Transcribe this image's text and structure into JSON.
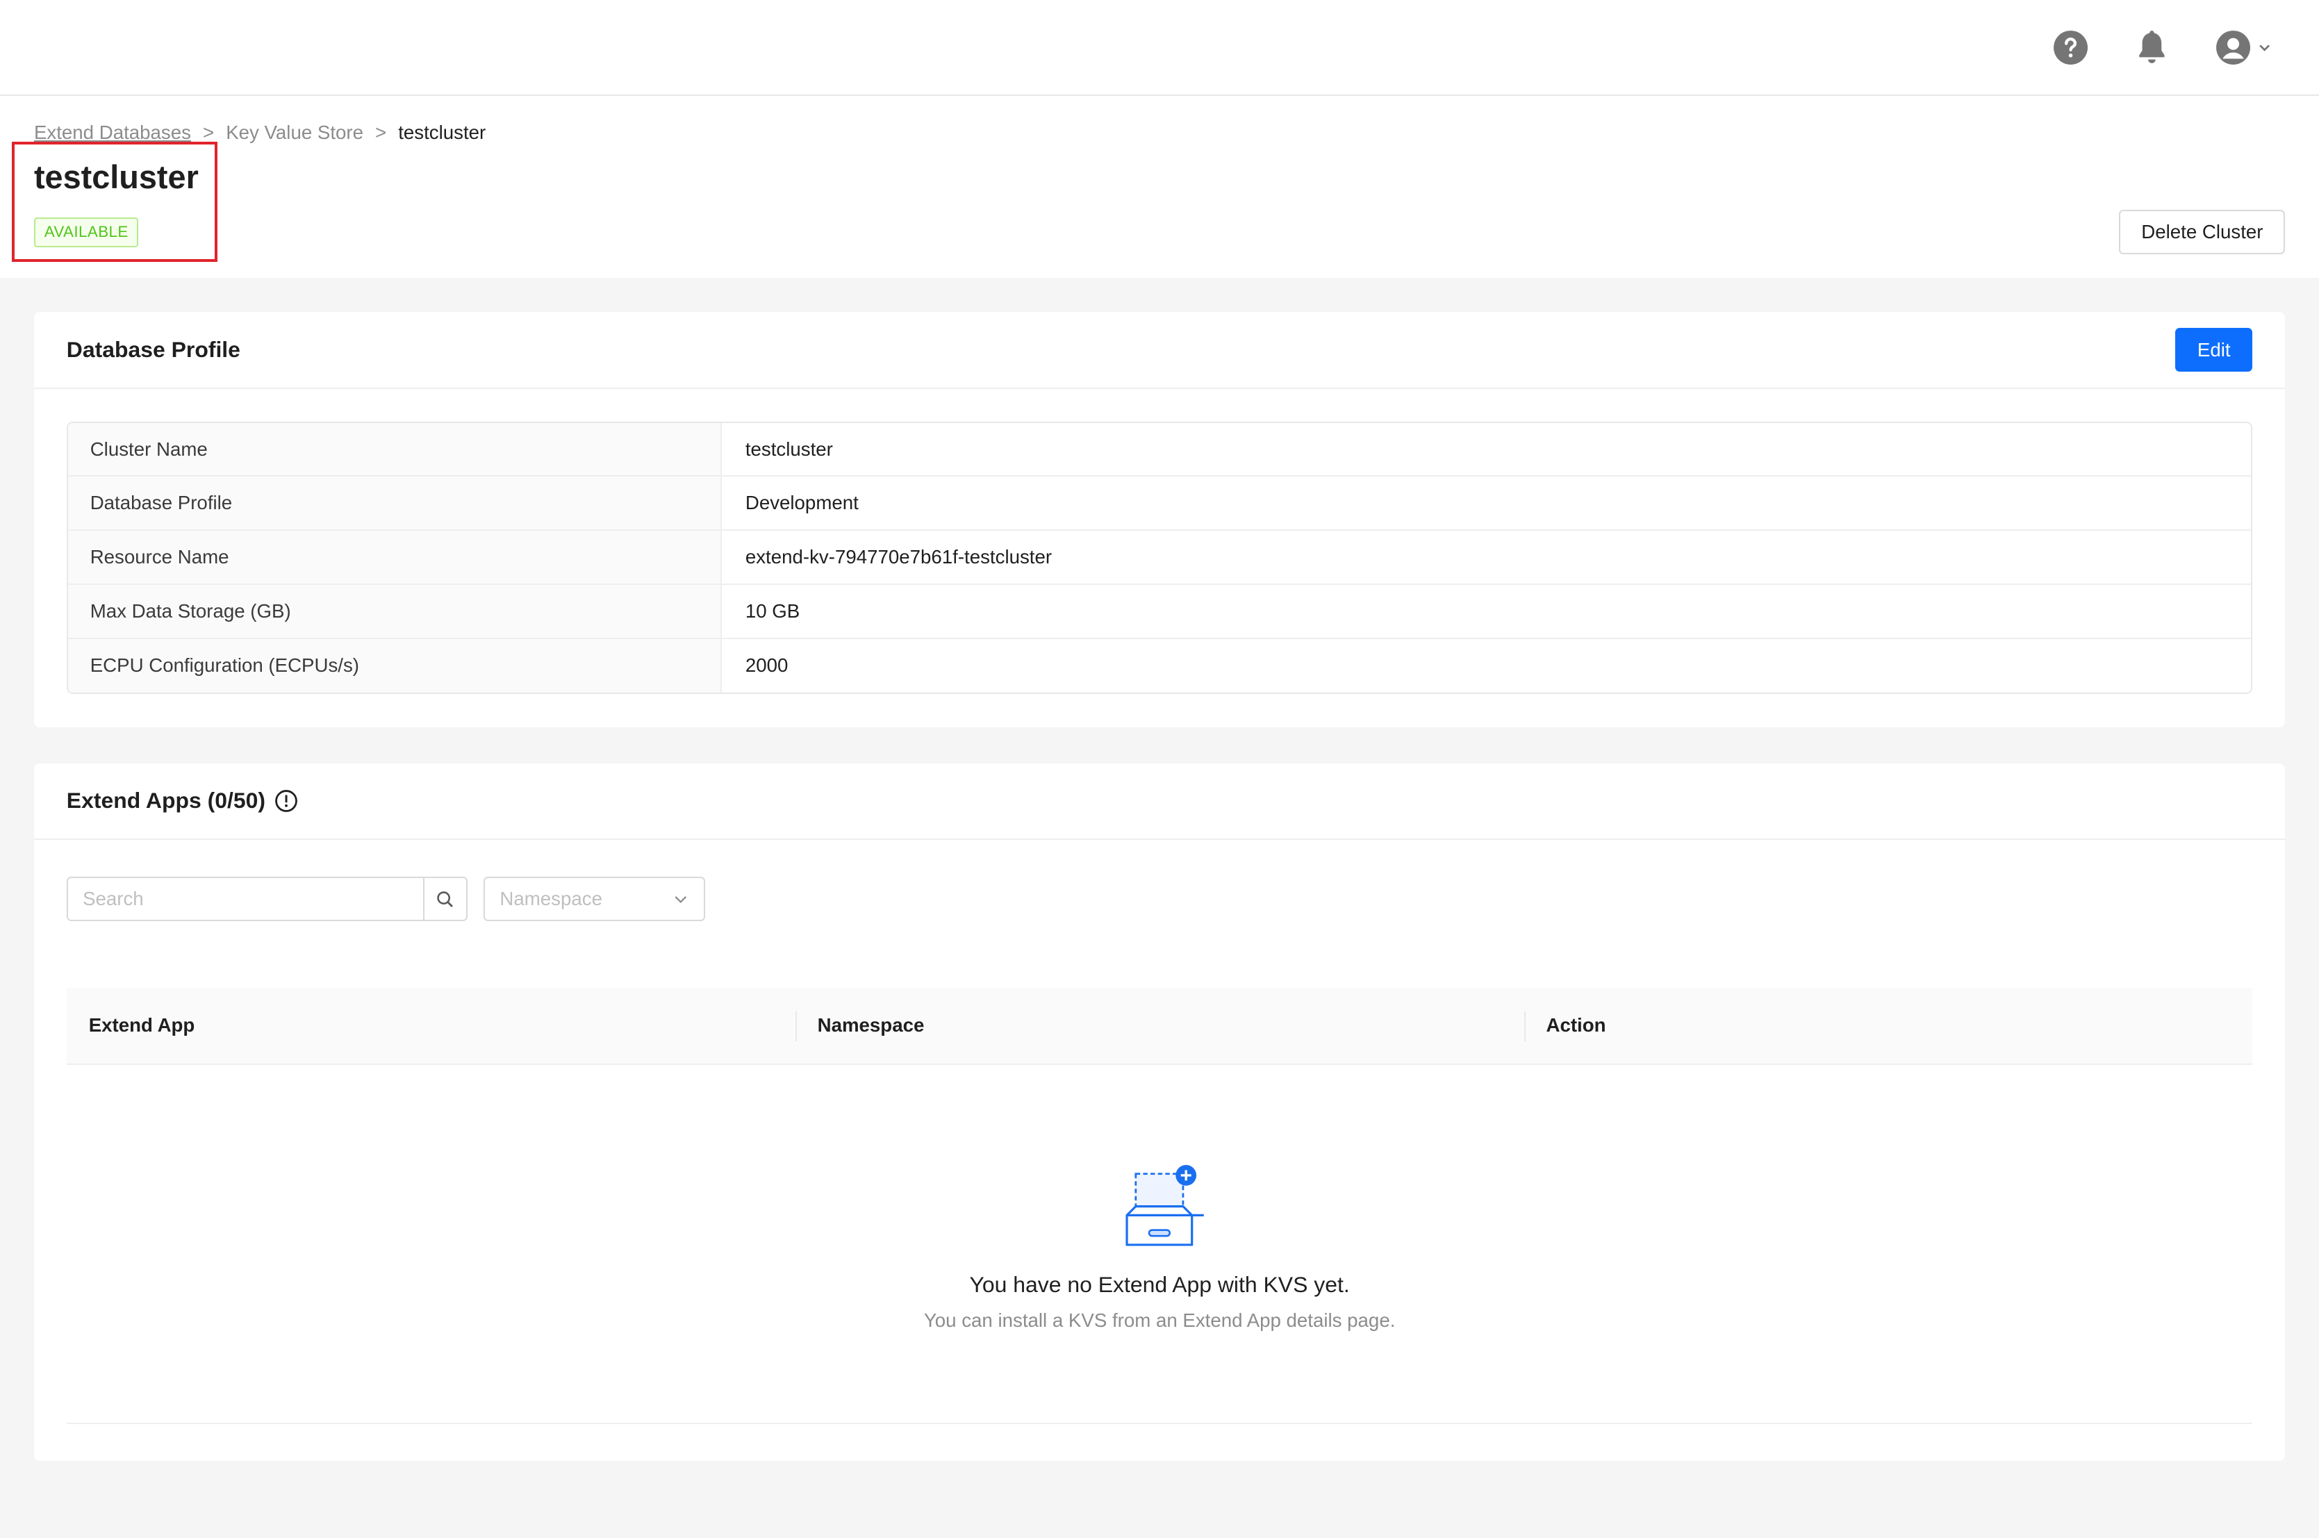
{
  "topbar": {
    "icons": [
      "help-icon",
      "bell-icon",
      "user-avatar-icon",
      "chevron-down-icon"
    ]
  },
  "breadcrumb": {
    "items": [
      "Extend Databases",
      "Key Value Store",
      "testcluster"
    ],
    "separator": ">"
  },
  "header": {
    "title": "testcluster",
    "status": "AVAILABLE",
    "delete_label": "Delete Cluster"
  },
  "profile": {
    "title": "Database Profile",
    "edit_label": "Edit",
    "rows": [
      {
        "label": "Cluster Name",
        "value": "testcluster"
      },
      {
        "label": "Database Profile",
        "value": "Development"
      },
      {
        "label": "Resource Name",
        "value": "extend-kv-794770e7b61f-testcluster"
      },
      {
        "label": "Max Data Storage (GB)",
        "value": "10 GB"
      },
      {
        "label": "ECPU Configuration (ECPUs/s)",
        "value": "2000"
      }
    ]
  },
  "apps": {
    "title": "Extend Apps (0/50)",
    "search_placeholder": "Search",
    "namespace_placeholder": "Namespace",
    "columns": [
      "Extend App",
      "Namespace",
      "Action"
    ],
    "empty_title": "You have no Extend App with KVS yet.",
    "empty_subtitle": "You can install a KVS from an Extend App details page."
  },
  "colors": {
    "primary": "#0d6efd",
    "status_available": "#52c41a",
    "highlight_box": "#e0242b"
  }
}
